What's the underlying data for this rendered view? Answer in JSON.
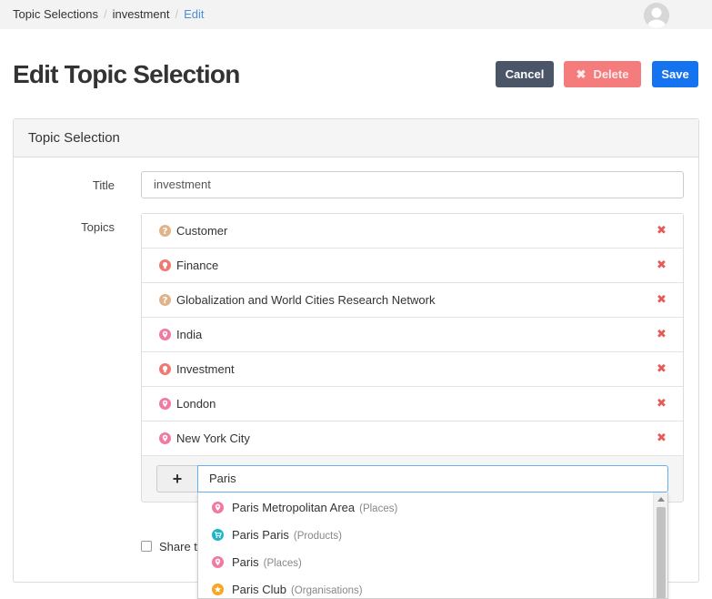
{
  "breadcrumb": {
    "items": [
      "Topic Selections",
      "investment",
      "Edit"
    ],
    "separator": "/"
  },
  "page": {
    "title": "Edit Topic Selection"
  },
  "actions": {
    "cancel": "Cancel",
    "delete": "Delete",
    "delete_icon": "✖",
    "save": "Save"
  },
  "panel": {
    "header": "Topic Selection",
    "title_label": "Title",
    "title_value": "investment",
    "topics_label": "Topics"
  },
  "topics": [
    {
      "label": "Customer",
      "icon": "question-icon",
      "color": "#e0b48a"
    },
    {
      "label": "Finance",
      "icon": "idea-icon",
      "color": "#ee7a72"
    },
    {
      "label": "Globalization and World Cities Research Network",
      "icon": "question-icon",
      "color": "#e0b48a"
    },
    {
      "label": "India",
      "icon": "place-pin-icon",
      "color": "#f07aa0"
    },
    {
      "label": "Investment",
      "icon": "idea-icon",
      "color": "#ee7a72"
    },
    {
      "label": "London",
      "icon": "place-pin-icon",
      "color": "#f07aa0"
    },
    {
      "label": "New York City",
      "icon": "place-pin-icon",
      "color": "#f07aa0"
    }
  ],
  "remove_icon": "✖",
  "add_button": "+",
  "search": {
    "value": "Paris"
  },
  "share": {
    "label": "Share t"
  },
  "suggestions": [
    {
      "name": "Paris Metropolitan Area",
      "type": "(Places)",
      "icon": "place-pin-icon",
      "color": "#f07aa0"
    },
    {
      "name": "Paris Paris",
      "type": "(Products)",
      "icon": "cart-icon",
      "color": "#1fb5c7"
    },
    {
      "name": "Paris",
      "type": "(Places)",
      "icon": "place-pin-icon",
      "color": "#f07aa0"
    },
    {
      "name": "Paris Club",
      "type": "(Organisations)",
      "icon": "star-icon",
      "color": "#f5a623"
    }
  ],
  "colors": {
    "cancel": "#4a5567",
    "delete": "#f47c7c",
    "save": "#1673f0",
    "remove": "#e85a5a",
    "breadcrumb_active": "#4a90d9"
  }
}
